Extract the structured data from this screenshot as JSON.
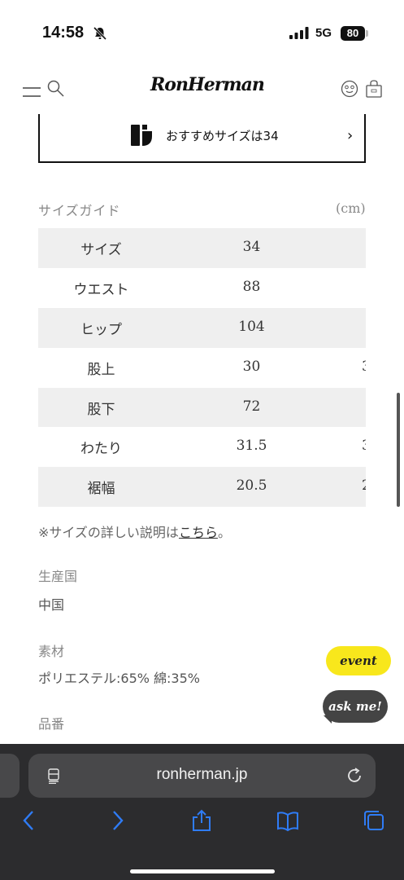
{
  "status": {
    "time": "14:58",
    "network": "5G",
    "battery": "80"
  },
  "header": {
    "logo": "RonHerman"
  },
  "recommend": {
    "text": "おすすめサイズは34",
    "chevron": "›"
  },
  "size_guide": {
    "title": "サイズガイド",
    "unit": "(cm)",
    "rows": [
      {
        "label": "サイズ",
        "value": "34",
        "next": ""
      },
      {
        "label": "ウエスト",
        "value": "88",
        "next": ""
      },
      {
        "label": "ヒップ",
        "value": "104",
        "next": ""
      },
      {
        "label": "股上",
        "value": "30",
        "next": "3"
      },
      {
        "label": "股下",
        "value": "72",
        "next": ""
      },
      {
        "label": "わたり",
        "value": "31.5",
        "next": "3"
      },
      {
        "label": "裾幅",
        "value": "20.5",
        "next": "2"
      }
    ]
  },
  "note": {
    "text": "※サイズの詳しい説明は",
    "link": "こちら",
    "suffix": "。"
  },
  "details": {
    "origin_label": "生産国",
    "origin_value": "中国",
    "material_label": "素材",
    "material_value": "ポリエステル:65% 綿:35%",
    "item_no_label": "品番"
  },
  "floating": {
    "event": "event",
    "ask": "ask me!"
  },
  "browser": {
    "url": "ronherman.jp"
  }
}
